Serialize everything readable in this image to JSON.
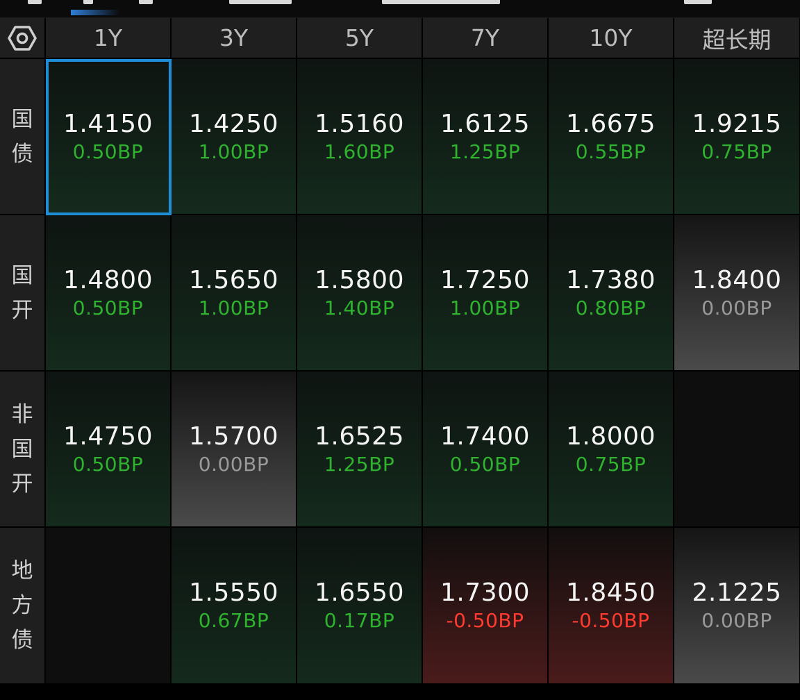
{
  "header": {
    "settings_icon": "settings-hexagon-icon",
    "tenors": [
      "1Y",
      "3Y",
      "5Y",
      "7Y",
      "10Y",
      "超长期"
    ]
  },
  "rows": [
    {
      "label": [
        "国",
        "债"
      ],
      "cells": [
        {
          "value": "1.4150",
          "change": "0.50BP",
          "trend": "up"
        },
        {
          "value": "1.4250",
          "change": "1.00BP",
          "trend": "up"
        },
        {
          "value": "1.5160",
          "change": "1.60BP",
          "trend": "up"
        },
        {
          "value": "1.6125",
          "change": "1.25BP",
          "trend": "up"
        },
        {
          "value": "1.6675",
          "change": "0.55BP",
          "trend": "up"
        },
        {
          "value": "1.9215",
          "change": "0.75BP",
          "trend": "up"
        }
      ]
    },
    {
      "label": [
        "国",
        "开"
      ],
      "cells": [
        {
          "value": "1.4800",
          "change": "0.50BP",
          "trend": "up"
        },
        {
          "value": "1.5650",
          "change": "1.00BP",
          "trend": "up"
        },
        {
          "value": "1.5800",
          "change": "1.40BP",
          "trend": "up"
        },
        {
          "value": "1.7250",
          "change": "1.00BP",
          "trend": "up"
        },
        {
          "value": "1.7380",
          "change": "0.80BP",
          "trend": "up"
        },
        {
          "value": "1.8400",
          "change": "0.00BP",
          "trend": "flat"
        }
      ]
    },
    {
      "label": [
        "非",
        "国",
        "开"
      ],
      "cells": [
        {
          "value": "1.4750",
          "change": "0.50BP",
          "trend": "up"
        },
        {
          "value": "1.5700",
          "change": "0.00BP",
          "trend": "flat"
        },
        {
          "value": "1.6525",
          "change": "1.25BP",
          "trend": "up"
        },
        {
          "value": "1.7400",
          "change": "0.50BP",
          "trend": "up"
        },
        {
          "value": "1.8000",
          "change": "0.75BP",
          "trend": "up"
        },
        {
          "value": "",
          "change": "",
          "trend": "empty"
        }
      ]
    },
    {
      "label": [
        "地",
        "方",
        "债"
      ],
      "cells": [
        {
          "value": "",
          "change": "",
          "trend": "empty"
        },
        {
          "value": "1.5550",
          "change": "0.67BP",
          "trend": "up"
        },
        {
          "value": "1.6550",
          "change": "0.17BP",
          "trend": "up"
        },
        {
          "value": "1.7300",
          "change": "-0.50BP",
          "trend": "down"
        },
        {
          "value": "1.8450",
          "change": "-0.50BP",
          "trend": "down"
        },
        {
          "value": "2.1225",
          "change": "0.00BP",
          "trend": "flat"
        }
      ]
    }
  ],
  "selected": {
    "row": 0,
    "col": 0
  },
  "colors": {
    "up": "#2fb32f",
    "down": "#ff3b30",
    "flat": "#9a9a9a",
    "selection": "#1e8fd6"
  }
}
